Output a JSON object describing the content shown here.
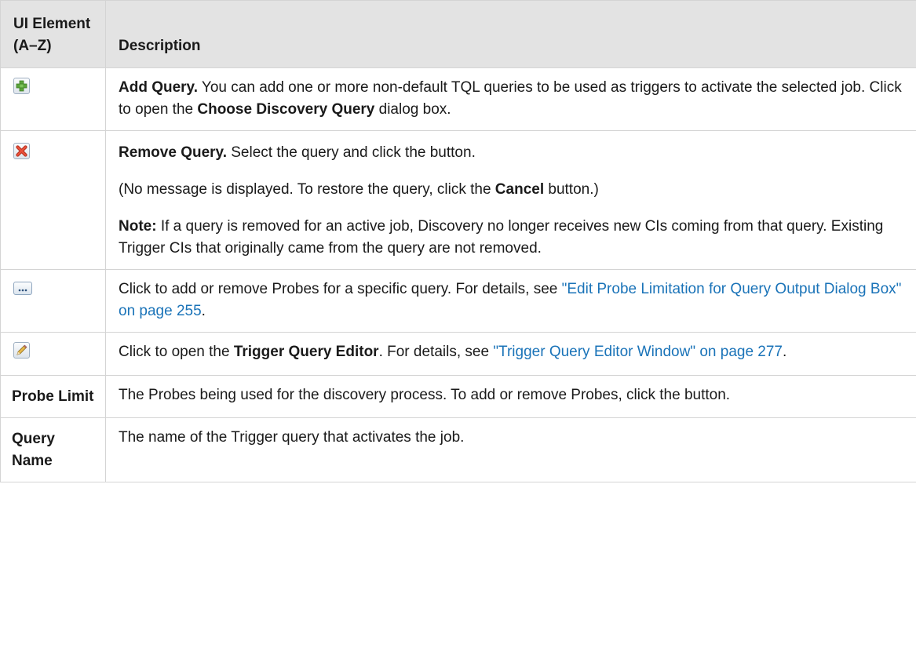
{
  "header": {
    "col1": "UI Element (A–Z)",
    "col2": "Description"
  },
  "rows": [
    {
      "icon": "add-query-icon",
      "name": "Add Query.",
      "t1": " You can add one or more non-default TQL queries to be used as triggers to activate the selected job. Click to open the ",
      "b1": "Choose Discovery Query",
      "t2": " dialog box."
    },
    {
      "icon": "remove-query-icon",
      "name": "Remove Query.",
      "t1": " Select the query and click the button.",
      "p2a": "(No message is displayed. To restore the query, click the ",
      "p2b": "Cancel",
      "p2c": " button.)",
      "note_label": "Note:",
      "note_text": " If a query is removed for an active job, Discovery no longer receives new CIs coming from that query. Existing Trigger CIs that originally came from the query are not removed."
    },
    {
      "icon": "ellipsis-icon",
      "t1": "Click to add or remove Probes for a specific query. For details, see ",
      "link": "\"Edit Probe Limitation for Query Output Dialog Box\" on page 255",
      "t2": "."
    },
    {
      "icon": "pencil-icon",
      "t1": "Click to open the ",
      "b1": "Trigger Query Editor",
      "t2": ". For details, see ",
      "link": "\"Trigger Query Editor Window\" on page 277",
      "t3": "."
    },
    {
      "element": "Probe Limit",
      "t1": "The Probes being used for the discovery process. To add or remove Probes, click the button."
    },
    {
      "element": "Query Name",
      "t1": "The name of the Trigger query that activates the job."
    }
  ]
}
